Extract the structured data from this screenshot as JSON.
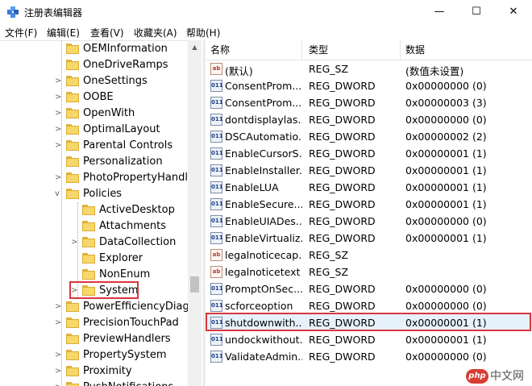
{
  "window": {
    "title": "注册表编辑器",
    "controls": {
      "minimize": "—",
      "maximize": "☐",
      "close": "✕"
    }
  },
  "menu": [
    "文件(F)",
    "编辑(E)",
    "查看(V)",
    "收藏夹(A)",
    "帮助(H)"
  ],
  "tree": {
    "items": [
      {
        "label": "OEMInformation",
        "expander": ""
      },
      {
        "label": "OneDriveRamps",
        "expander": ""
      },
      {
        "label": "OneSettings",
        "expander": ">"
      },
      {
        "label": "OOBE",
        "expander": ">"
      },
      {
        "label": "OpenWith",
        "expander": ">"
      },
      {
        "label": "OptimalLayout",
        "expander": ">"
      },
      {
        "label": "Parental Controls",
        "expander": ">"
      },
      {
        "label": "Personalization",
        "expander": ""
      },
      {
        "label": "PhotoPropertyHandler",
        "expander": ">"
      },
      {
        "label": "Policies",
        "expander": "v"
      },
      {
        "label": "ActiveDesktop",
        "expander": ""
      },
      {
        "label": "Attachments",
        "expander": ""
      },
      {
        "label": "DataCollection",
        "expander": ">"
      },
      {
        "label": "Explorer",
        "expander": ""
      },
      {
        "label": "NonEnum",
        "expander": ""
      },
      {
        "label": "System",
        "expander": ">"
      },
      {
        "label": "PowerEfficiencyDiagno",
        "expander": ">"
      },
      {
        "label": "PrecisionTouchPad",
        "expander": ">"
      },
      {
        "label": "PreviewHandlers",
        "expander": ""
      },
      {
        "label": "PropertySystem",
        "expander": ">"
      },
      {
        "label": "Proximity",
        "expander": ">"
      },
      {
        "label": "PushNotifications",
        "expander": ">"
      }
    ]
  },
  "values": {
    "columns": {
      "name": "名称",
      "type": "类型",
      "data": "数据"
    },
    "rows": [
      {
        "icon": "ab",
        "name": "(默认)",
        "type": "REG_SZ",
        "data": "(数值未设置)"
      },
      {
        "icon": "011",
        "name": "ConsentProm...",
        "type": "REG_DWORD",
        "data": "0x00000000 (0)"
      },
      {
        "icon": "011",
        "name": "ConsentProm...",
        "type": "REG_DWORD",
        "data": "0x00000003 (3)"
      },
      {
        "icon": "011",
        "name": "dontdisplaylas...",
        "type": "REG_DWORD",
        "data": "0x00000000 (0)"
      },
      {
        "icon": "011",
        "name": "DSCAutomatio...",
        "type": "REG_DWORD",
        "data": "0x00000002 (2)"
      },
      {
        "icon": "011",
        "name": "EnableCursorS...",
        "type": "REG_DWORD",
        "data": "0x00000001 (1)"
      },
      {
        "icon": "011",
        "name": "EnableInstaller...",
        "type": "REG_DWORD",
        "data": "0x00000001 (1)"
      },
      {
        "icon": "011",
        "name": "EnableLUA",
        "type": "REG_DWORD",
        "data": "0x00000001 (1)"
      },
      {
        "icon": "011",
        "name": "EnableSecure...",
        "type": "REG_DWORD",
        "data": "0x00000001 (1)"
      },
      {
        "icon": "011",
        "name": "EnableUIADes...",
        "type": "REG_DWORD",
        "data": "0x00000000 (0)"
      },
      {
        "icon": "011",
        "name": "EnableVirtualiz...",
        "type": "REG_DWORD",
        "data": "0x00000001 (1)"
      },
      {
        "icon": "ab",
        "name": "legalnoticecap...",
        "type": "REG_SZ",
        "data": ""
      },
      {
        "icon": "ab",
        "name": "legalnoticetext",
        "type": "REG_SZ",
        "data": ""
      },
      {
        "icon": "011",
        "name": "PromptOnSec...",
        "type": "REG_DWORD",
        "data": "0x00000000 (0)"
      },
      {
        "icon": "011",
        "name": "scforceoption",
        "type": "REG_DWORD",
        "data": "0x00000000 (0)"
      },
      {
        "icon": "011",
        "name": "shutdownwith...",
        "type": "REG_DWORD",
        "data": "0x00000001 (1)"
      },
      {
        "icon": "011",
        "name": "undockwithout...",
        "type": "REG_DWORD",
        "data": "0x00000001 (1)"
      },
      {
        "icon": "011",
        "name": "ValidateAdmin...",
        "type": "REG_DWORD",
        "data": "0x00000000 (0)"
      }
    ]
  },
  "watermark": {
    "badge": "php",
    "text": "中文网"
  },
  "colors": {
    "highlight_border": "#d9363e",
    "selection": "#e5f1fb",
    "folder": "#f7d66a"
  }
}
